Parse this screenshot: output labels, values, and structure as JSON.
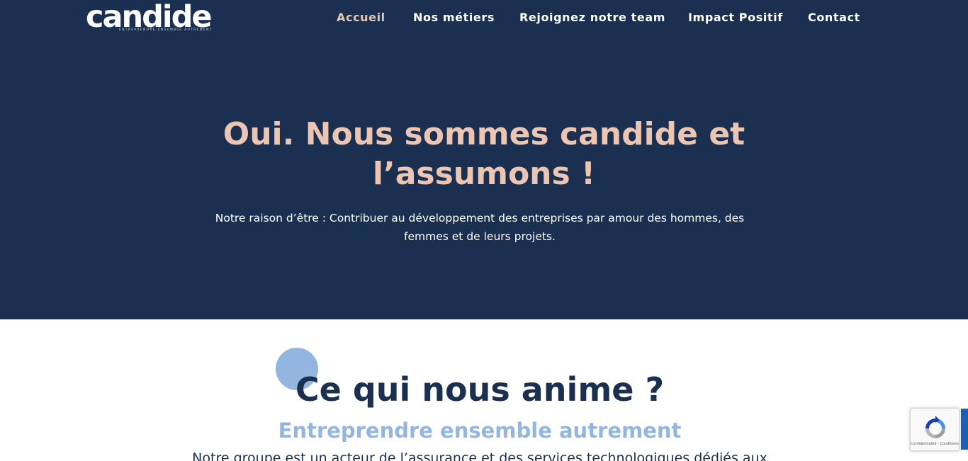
{
  "logo": {
    "wordmark": "candide",
    "tagline": "ENTREPRENDRE ENSEMBLE AUTREMENT"
  },
  "nav": {
    "items": [
      {
        "label": "Accueil",
        "active": true
      },
      {
        "label": "Nos métiers",
        "active": false
      },
      {
        "label": "Rejoignez notre team",
        "active": false
      },
      {
        "label": "Impact Positif",
        "active": false
      },
      {
        "label": "Contact",
        "active": false
      }
    ]
  },
  "hero": {
    "title": "Oui. Nous sommes candide et l’assumons !",
    "subtitle": "Notre raison d’être : Contribuer au développement des entreprises par amour des hommes, des femmes et de leurs projets."
  },
  "section": {
    "title": "Ce qui nous anime ?",
    "subtitle": "Entreprendre ensemble autrement",
    "body": "Notre groupe est un acteur de l’assurance et des services technologiques dédiés aux"
  },
  "recaptcha": {
    "links": "Confidentialité - Conditions"
  },
  "colors": {
    "navy": "#1b3050",
    "peach": "#ecc6b3",
    "light_blue": "#93b6e0",
    "scroll_blue": "#1f5fae"
  }
}
